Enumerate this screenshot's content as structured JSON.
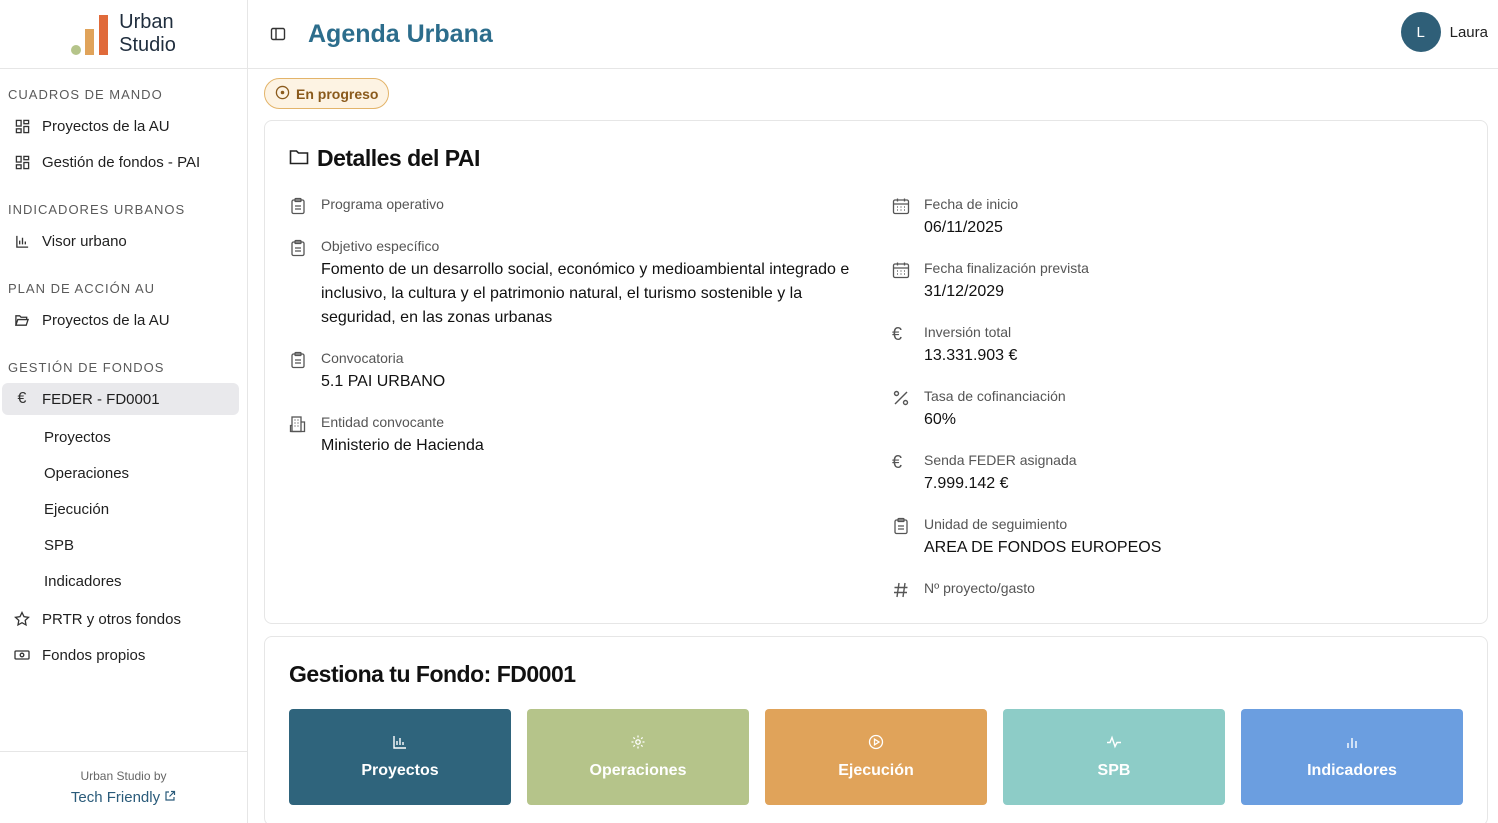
{
  "brand": {
    "line1": "Urban",
    "line2": "Studio"
  },
  "header": {
    "title": "Agenda Urbana",
    "user_initial": "L",
    "user_name": "Laura"
  },
  "sidebar": {
    "sections": [
      {
        "title": "CUADROS DE MANDO",
        "items": [
          "Proyectos de la AU",
          "Gestión de fondos - PAI"
        ]
      },
      {
        "title": "INDICADORES URBANOS",
        "items": [
          "Visor urbano"
        ]
      },
      {
        "title": "PLAN DE ACCIÓN AU",
        "items": [
          "Proyectos de la AU"
        ]
      },
      {
        "title": "GESTIÓN DE FONDOS",
        "items": [
          "FEDER - FD0001"
        ]
      }
    ],
    "subitems": [
      "Proyectos",
      "Operaciones",
      "Ejecución",
      "SPB",
      "Indicadores"
    ],
    "extra": [
      "PRTR y otros fondos",
      "Fondos propios"
    ],
    "footer_by": "Urban Studio by",
    "footer_link": "Tech Friendly"
  },
  "status": "En progreso",
  "details": {
    "title": "Detalles del PAI",
    "left": [
      {
        "label": "Programa operativo",
        "value": ""
      },
      {
        "label": "Objetivo específico",
        "value": "Fomento de un desarrollo social, económico y medioambiental integrado e inclusivo, la cultura y el patrimonio natural, el turismo sostenible y la seguridad, en las zonas urbanas"
      },
      {
        "label": "Convocatoria",
        "value": "5.1 PAI URBANO"
      },
      {
        "label": "Entidad convocante",
        "value": "Ministerio de Hacienda"
      }
    ],
    "right": [
      {
        "label": "Fecha de inicio",
        "value": "06/11/2025"
      },
      {
        "label": "Fecha finalización prevista",
        "value": "31/12/2029"
      },
      {
        "label": "Inversión total",
        "value": "13.331.903 €"
      },
      {
        "label": "Tasa de cofinanciación",
        "value": "60%"
      },
      {
        "label": "Senda FEDER asignada",
        "value": "7.999.142 €"
      },
      {
        "label": "Unidad de seguimiento",
        "value": "AREA DE FONDOS EUROPEOS"
      },
      {
        "label": "Nº proyecto/gasto",
        "value": ""
      }
    ]
  },
  "fund": {
    "title": "Gestiona tu Fondo: FD0001",
    "tiles": [
      {
        "label": "Proyectos",
        "color": "#2f647c"
      },
      {
        "label": "Operaciones",
        "color": "#b5c48a"
      },
      {
        "label": "Ejecución",
        "color": "#e0a35a"
      },
      {
        "label": "SPB",
        "color": "#8dccc7"
      },
      {
        "label": "Indicadores",
        "color": "#6b9ee0"
      }
    ]
  }
}
